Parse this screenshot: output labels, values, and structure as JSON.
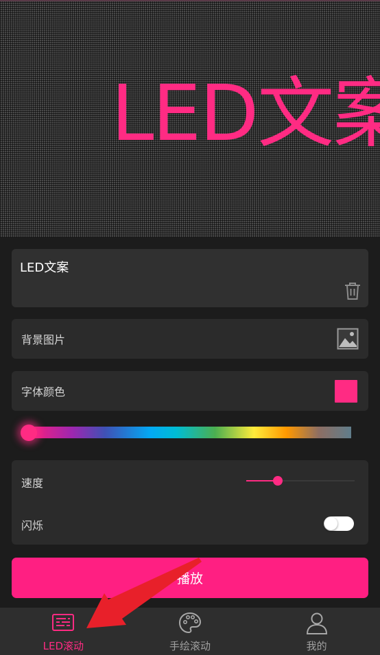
{
  "led_preview": {
    "display_text": "LED文案",
    "text_color": "#ff2b83"
  },
  "text_input": {
    "value": "LED文案",
    "delete_icon": "trash-icon"
  },
  "background_image": {
    "label": "背景图片",
    "icon": "image-icon"
  },
  "font_color": {
    "label": "字体颜色",
    "selected_color": "#ff2b83"
  },
  "hue_slider": {
    "position": 0
  },
  "settings": {
    "speed_label": "速度",
    "speed_value": 0.29,
    "flash_label": "闪烁",
    "flash_enabled": false
  },
  "play_button": {
    "label": "播放"
  },
  "bottom_nav": {
    "items": [
      {
        "label": "LED滚动",
        "icon": "led-board-icon",
        "active": true
      },
      {
        "label": "手绘滚动",
        "icon": "palette-icon",
        "active": false
      },
      {
        "label": "我的",
        "icon": "user-icon",
        "active": false
      }
    ]
  },
  "colors": {
    "accent": "#ff1f82",
    "background": "#1c1c1c",
    "card": "#2b2b2b",
    "nav_background": "#2e2e2e",
    "annotation_arrow": "#e8202a"
  }
}
